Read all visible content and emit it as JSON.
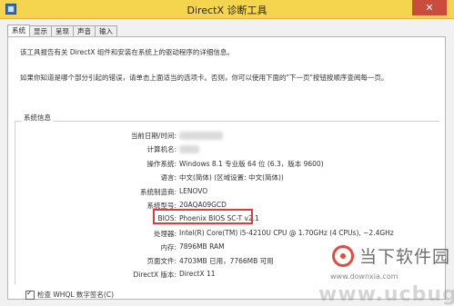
{
  "window": {
    "title": "DirectX 诊断工具",
    "close_symbol": "✕"
  },
  "tabs": [
    {
      "label": "系统",
      "active": true
    },
    {
      "label": "显示",
      "active": false
    },
    {
      "label": "呈现",
      "active": false
    },
    {
      "label": "声音",
      "active": false
    },
    {
      "label": "输入",
      "active": false
    }
  ],
  "intro": {
    "line1": "该工具报告有关 DirectX 组件和安装在系统上的驱动程序的详细信息。",
    "line2": "如果你知道是哪个部分引起的错误，请单击上面适当的选项卡。否则，你可以使用下面的\"下一页\"按钮按顺序查阅每一页。"
  },
  "system_info": {
    "group_title": "系统信息",
    "rows": [
      {
        "label": "当前日期/时间:",
        "value": ""
      },
      {
        "label": "计算机名:",
        "value": ""
      },
      {
        "label": "操作系统:",
        "value": "Windows 8.1 专业版 64 位 (6.3，版本 9600)"
      },
      {
        "label": "语言:",
        "value": "中文(简体) (区域设置: 中文(简体))"
      },
      {
        "label": "系统制造商:",
        "value": "LENOVO"
      },
      {
        "label": "系统型号:",
        "value": "20AQA09GCD"
      },
      {
        "label": "BIOS:",
        "value": "Phoenix BIOS SC-T v2.1"
      },
      {
        "label": "处理器:",
        "value": "Intel(R) Core(TM) i5-4210U CPU @ 1.70GHz (4 CPUs), ~2.4GHz"
      },
      {
        "label": "内存:",
        "value": "7896MB RAM"
      },
      {
        "label": "页面文件:",
        "value": "4703MB 已用，7766MB 可用"
      },
      {
        "label": "DirectX 版本:",
        "value": "DirectX 11"
      }
    ]
  },
  "whql": {
    "label": "检查 WHQL 数字签名(C)",
    "checked": true
  },
  "watermark": {
    "brand": "当下软件园",
    "url_small": "www.downxia.com",
    "url_large": "www.ucbug.com",
    "accent": "#e64a3e"
  }
}
